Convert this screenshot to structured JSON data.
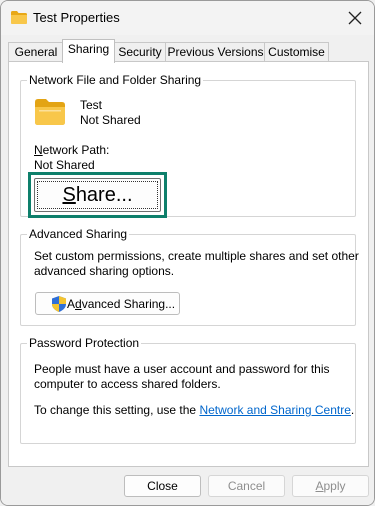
{
  "window": {
    "title": "Test Properties"
  },
  "tabs": [
    {
      "label": "General"
    },
    {
      "label": "Sharing"
    },
    {
      "label": "Security"
    },
    {
      "label": "Previous Versions"
    },
    {
      "label": "Customise"
    }
  ],
  "network_sharing": {
    "legend": "Network File and Folder Sharing",
    "folder_name": "Test",
    "folder_status": "Not Shared",
    "network_path_label_first": "N",
    "network_path_label_rest": "etwork Path:",
    "network_path_value": "Not Shared",
    "share_first": "S",
    "share_rest": "hare..."
  },
  "advanced_sharing": {
    "legend": "Advanced Sharing",
    "description_line1": "Set custom permissions, create multiple shares and set other",
    "description_line2": "advanced sharing options.",
    "button_pre": "A",
    "button_under": "d",
    "button_post": "vanced Sharing..."
  },
  "password_protection": {
    "legend": "Password Protection",
    "line1": "People must have a user account and password for this",
    "line2": "computer to access shared folders.",
    "line3_prefix": "To change this setting, use the ",
    "link_text": "Network and Sharing Centre",
    "line3_suffix": "."
  },
  "footer": {
    "close_label": "Close",
    "cancel_label": "Cancel",
    "apply_first": "A",
    "apply_rest": "pply"
  },
  "colors": {
    "highlight_border": "#0e7f6b",
    "link": "#0066cc",
    "folder_yellow": "#f6c343"
  }
}
